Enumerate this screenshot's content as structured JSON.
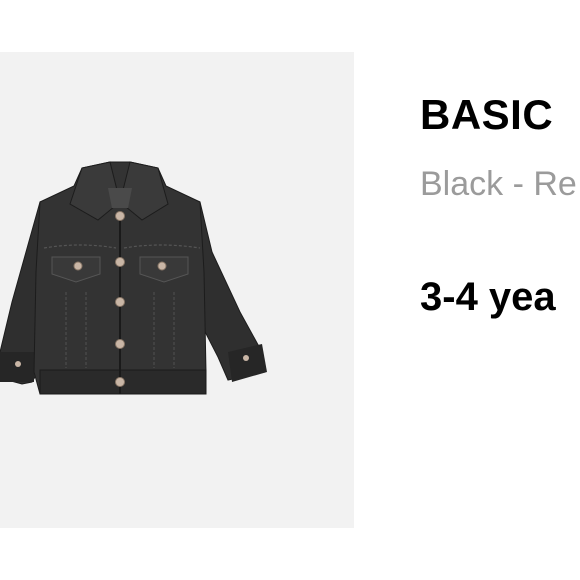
{
  "product": {
    "image_alt": "Black denim jacket",
    "title": "BASIC",
    "color": "Black - Re",
    "size": "3-4 yea",
    "colors": {
      "panel_background": "#f2f2f2",
      "denim": "#2b2b2b",
      "title_text": "#000000",
      "color_text": "#9b9b9b"
    }
  }
}
